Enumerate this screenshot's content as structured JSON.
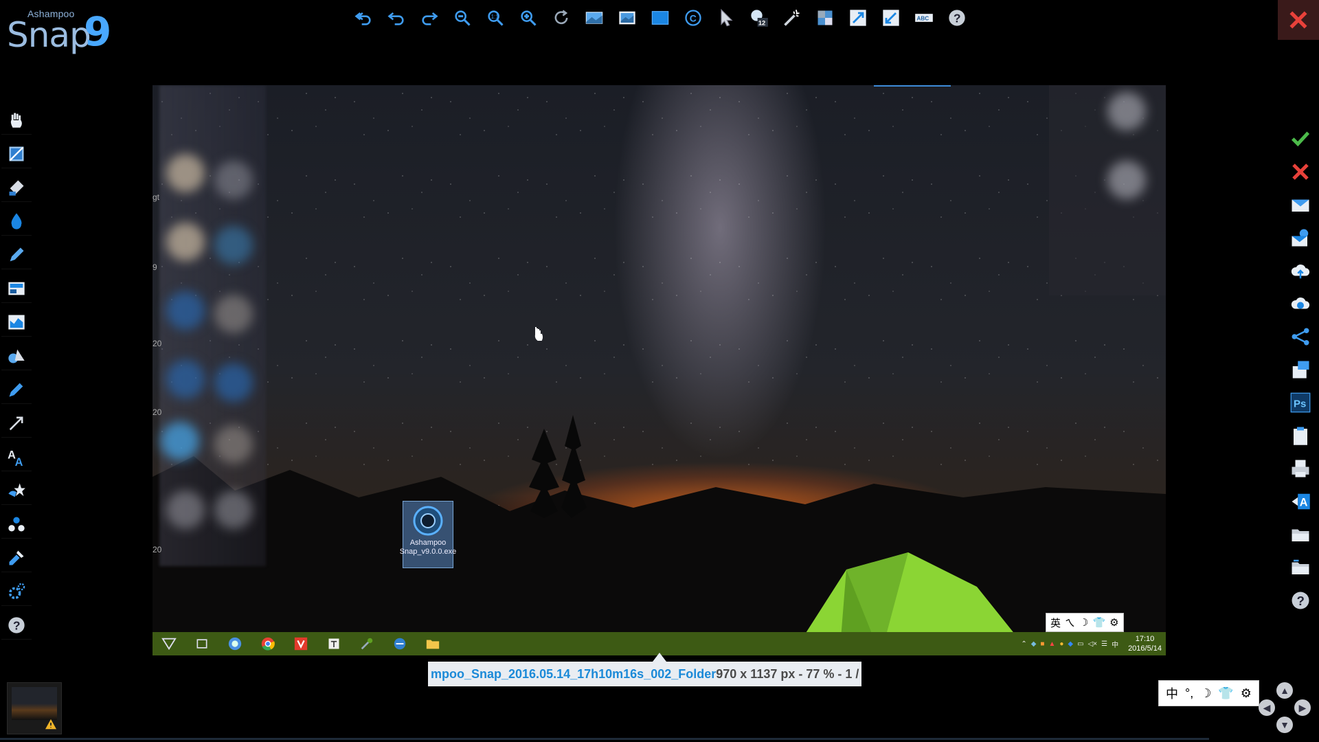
{
  "app": {
    "brand": "Ashampoo",
    "name": "Snap",
    "version": "9"
  },
  "top_toolbar": {
    "items": [
      "undo-all-icon",
      "undo-icon",
      "redo-icon",
      "zoom-out-icon",
      "zoom-1to1-icon",
      "zoom-in-icon",
      "rotate-icon",
      "image-icon",
      "image-frame-icon",
      "solid-rect-icon",
      "copyright-icon",
      "pointer-icon",
      "counter-icon",
      "magic-wand-icon",
      "pixelate-icon",
      "resize-icon",
      "crop-resize-icon",
      "text-recognition-icon",
      "help-icon"
    ]
  },
  "left_toolbar": {
    "items": [
      "hand-icon",
      "crop-icon",
      "highlight-marker-icon",
      "blur-drop-icon",
      "pen-icon",
      "layout-icon",
      "chart-icon",
      "shapes-icon",
      "pencil-icon",
      "arrow-icon",
      "text-icon",
      "stamp-icon",
      "numbering-icon",
      "color-picker-icon",
      "settings-icon",
      "help-icon"
    ]
  },
  "right_toolbar": {
    "items": [
      "accept-icon",
      "discard-icon",
      "email-icon",
      "email-outlook-icon",
      "cloud-upload-icon",
      "cloud-share-icon",
      "share-icon",
      "print-doc-icon",
      "photoshop-icon",
      "clipboard-icon",
      "printer-icon",
      "text-export-icon",
      "open-folder-icon",
      "save-folder-icon",
      "help-icon"
    ],
    "ps_label": "Ps"
  },
  "canvas": {
    "desktop_icon_label": "Ashampoo Snap_v9.0.0.exe",
    "left_edge_digits": [
      "gt",
      "9",
      "20",
      "20",
      "20"
    ],
    "taskbar": {
      "clock_time": "17:10",
      "clock_date": "2016/5/14",
      "tray_lang": "中"
    },
    "ime": {
      "lang": "英",
      "items": [
        "ㄟ",
        "☽",
        "👕",
        "⚙"
      ]
    }
  },
  "status": {
    "filename": "mpoo_Snap_2016.05.14_17h10m16s_002_Folder",
    "info": "970 x 1137 px - 77 % - 1 / "
  },
  "ime_bottom": {
    "lang": "中",
    "items": [
      "°,",
      "☽",
      "👕",
      "⚙"
    ]
  },
  "colors": {
    "accent": "#1c8ad8",
    "close_red": "#e8413a",
    "accept_green": "#4cbb4a",
    "tent_green": "#8bd534",
    "taskbar_green": "#3d5a14"
  }
}
